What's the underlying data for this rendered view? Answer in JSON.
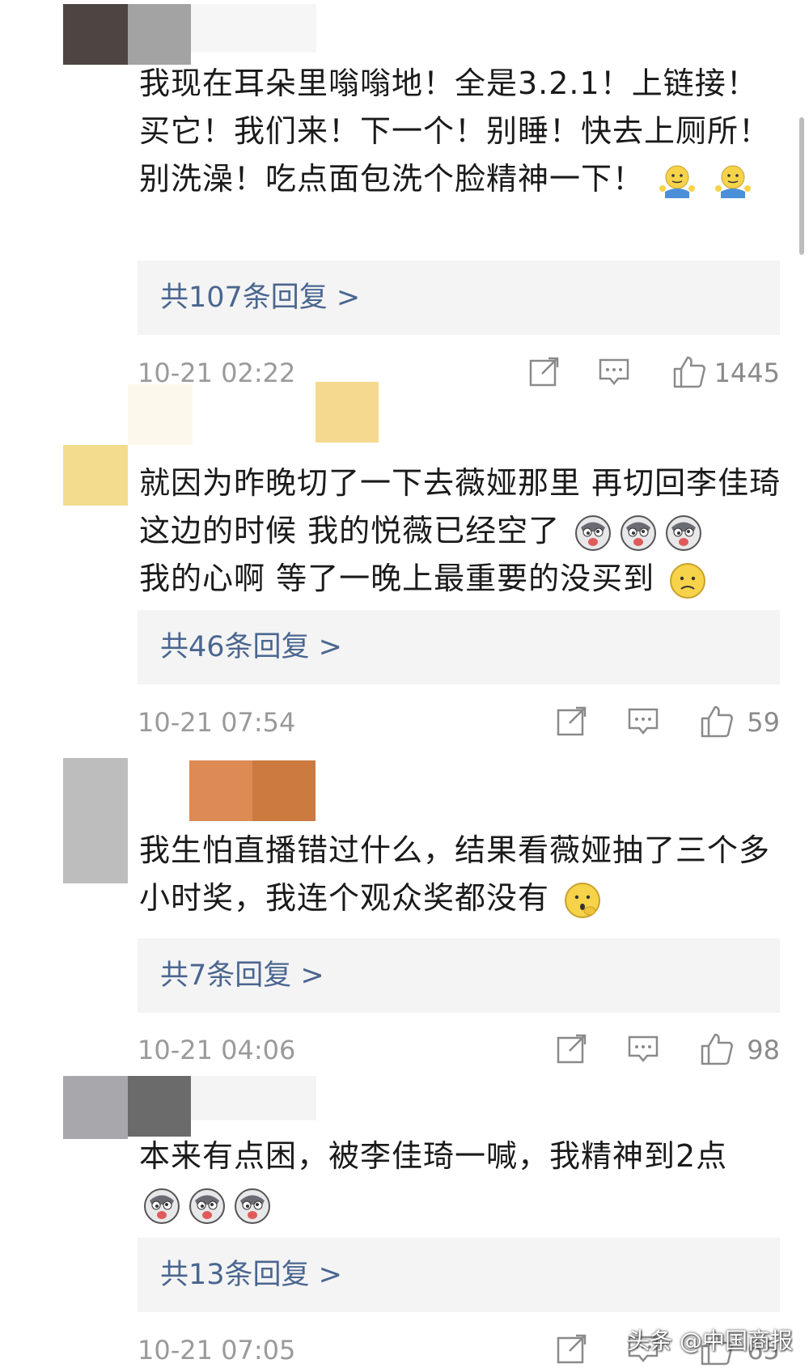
{
  "comments": [
    {
      "text": "我现在耳朵里嗡嗡地！全是3.2.1！上链接！买它！我们来！下一个！别睡！快去上厕所！别洗澡！吃点面包洗个脸精神一下！",
      "emojis": [
        "shrug-emoji",
        "shrug-emoji"
      ],
      "replies": "共107条回复 >",
      "time": "10-21 02:22",
      "likes": "1445"
    },
    {
      "text": "就因为昨晚切了一下去薇娅那里 再切回李佳琦这边的时候 我的悦薇已经空了",
      "text2": "我的心啊 等了一晚上最重要的没买到",
      "emojis": [
        "husky-emoji",
        "husky-emoji",
        "husky-emoji"
      ],
      "emojis2": [
        "sad-emoji"
      ],
      "replies": "共46条回复 >",
      "time": "10-21 07:54",
      "likes": "59"
    },
    {
      "text": "我生怕直播错过什么，结果看薇娅抽了三个多小时奖，我连个观众奖都没有",
      "emojis": [
        "shy-emoji"
      ],
      "replies": "共7条回复 >",
      "time": "10-21 04:06",
      "likes": "98"
    },
    {
      "text": "本来有点困，被李佳琦一喊，我精神到2点",
      "emojis": [
        "husky-emoji",
        "husky-emoji",
        "husky-emoji"
      ],
      "replies": "共13条回复 >",
      "time": "10-21 07:05",
      "likes": "65"
    }
  ],
  "watermark": "头条 @中国商报"
}
